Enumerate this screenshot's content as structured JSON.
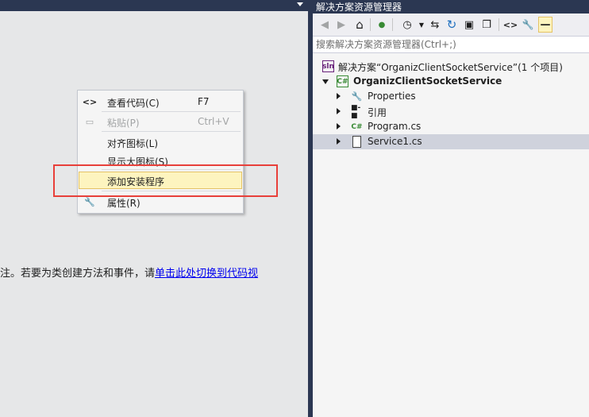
{
  "designer": {
    "hint_text": "注。若要为类创建方法和事件，请",
    "hint_link": "单击此处切换到代码视"
  },
  "context_menu": {
    "items": [
      {
        "label": "查看代码(C)",
        "shortcut": "F7",
        "icon": "code-brackets-icon",
        "glyph": "<>"
      },
      {
        "label": "粘贴(P)",
        "shortcut": "Ctrl+V",
        "icon": "paste-icon",
        "glyph": "▭"
      },
      {
        "label": "对齐图标(L)",
        "shortcut": "",
        "icon": "",
        "glyph": ""
      },
      {
        "label": "显示大图标(S)",
        "shortcut": "",
        "icon": "",
        "glyph": ""
      },
      {
        "label": "添加安装程序",
        "shortcut": "",
        "icon": "",
        "glyph": ""
      },
      {
        "label": "属性(R)",
        "shortcut": "",
        "icon": "wrench-icon",
        "glyph": "🔧"
      }
    ]
  },
  "solution_explorer": {
    "title": "解决方案资源管理器",
    "search_placeholder": "搜索解决方案资源管理器(Ctrl+;)",
    "toolbar": [
      {
        "icon": "back-icon",
        "glyph": "◀"
      },
      {
        "icon": "forward-icon",
        "glyph": "▶"
      },
      {
        "icon": "home-icon",
        "glyph": "⌂"
      },
      {
        "icon": "pending-changes-icon",
        "glyph": "●"
      },
      {
        "icon": "history-icon",
        "glyph": "◷"
      },
      {
        "icon": "sync-icon",
        "glyph": "⇆"
      },
      {
        "icon": "refresh-icon",
        "glyph": "↻"
      },
      {
        "icon": "collapse-all-icon",
        "glyph": "▣"
      },
      {
        "icon": "copy-icon",
        "glyph": "❐"
      },
      {
        "icon": "view-code-icon",
        "glyph": "<>"
      },
      {
        "icon": "properties-icon",
        "glyph": "🔧"
      },
      {
        "icon": "pin-icon",
        "glyph": "—"
      }
    ],
    "tree": {
      "solution": "解决方案“OrganizClientSocketService”(1 个项目)",
      "project": "OrganizClientSocketService",
      "properties": "Properties",
      "references": "引用",
      "program": "Program.cs",
      "service": "Service1.cs"
    },
    "badges": {
      "sln": "sln",
      "csproj": "C#",
      "cs": "C#"
    }
  },
  "colors": {
    "chrome": "#2b3752",
    "designer_bg": "#e6e7e8",
    "highlight": "#fdf4bf",
    "annotation_red": "#e8403a",
    "selected_row": "#cfd2dc"
  }
}
